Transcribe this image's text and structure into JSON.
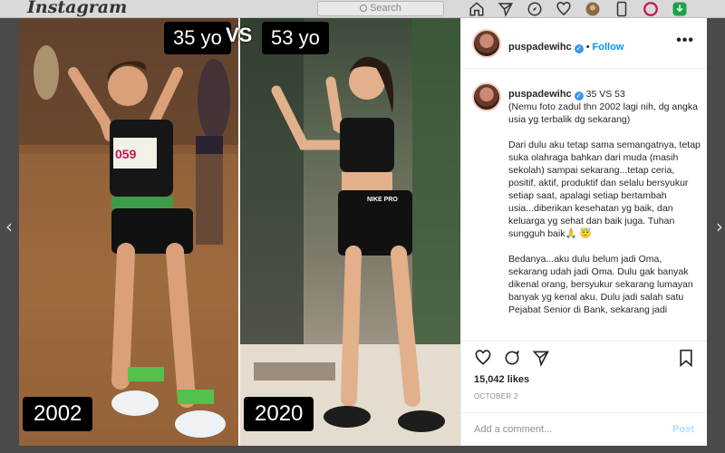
{
  "header": {
    "logo": "Instagram",
    "search_placeholder": "Search"
  },
  "photo": {
    "label_left": "35 yo",
    "vs": "VS",
    "label_right": "53 yo",
    "year_left": "2002",
    "year_right": "2020",
    "bib_number": "059",
    "shorts_brand": "NIKE PRO"
  },
  "post": {
    "username": "puspadewihc",
    "follow_label": "Follow",
    "more_label": "•••",
    "caption_title": "35 VS 53",
    "caption_paragraphs": [
      "(Nemu foto zadul thn 2002 lagi nih, dg angka usia yg terbalik dg sekarang)",
      "Dari dulu aku tetap sama semangatnya, tetap suka olahraga bahkan dari muda (masih sekolah) sampai sekarang...tetap ceria, positif, aktif, produktif dan selalu bersyukur setiap saat, apalagi setiap bertambah usia...diberikan kesehatan yg baik, dan keluarga yg sehat dan baik juga. Tuhan sungguh baik🙏 😇",
      "Bedanya...aku dulu belum jadi Oma, sekarang udah jadi Oma. Dulu gak banyak dikenal orang, bersyukur sekarang lumayan banyak yg kenal aku. Dulu jadi salah satu Pejabat Senior di Bank, sekarang jadi"
    ],
    "likes": "15,042 likes",
    "date": "OCTOBER 2",
    "comment_placeholder": "Add a comment...",
    "post_label": "Post"
  },
  "colors": {
    "accent": "#0095f6",
    "verified": "#3897f0",
    "text": "#262626",
    "muted": "#8e8e8e"
  }
}
